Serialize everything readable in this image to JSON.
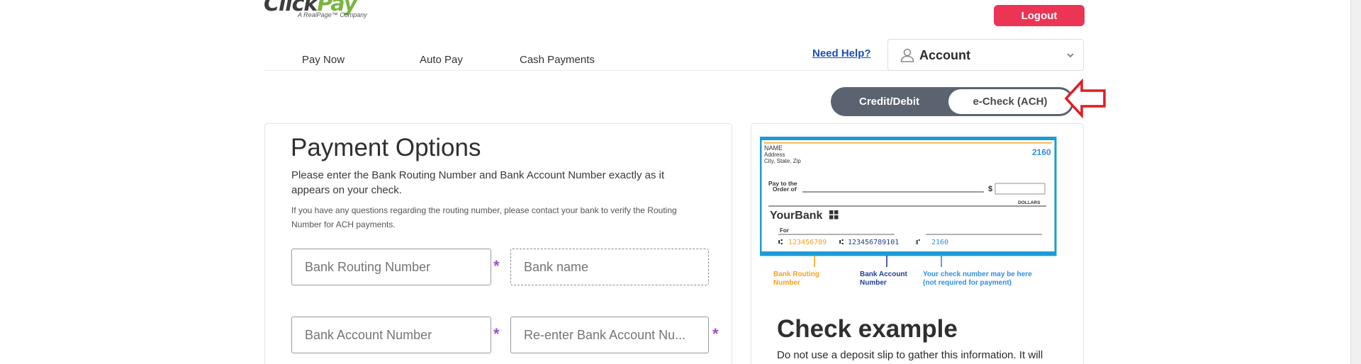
{
  "brand": {
    "logo_main": "ClickPay",
    "logo_main_a": "Click",
    "logo_main_b": "Pay",
    "logo_tagline": "A RealPage™ Company"
  },
  "header": {
    "logout_label": "Logout",
    "need_help_label": "Need Help?",
    "account_label": "Account",
    "icons": {
      "account": "person-icon",
      "dropdown": "chevron-down-icon"
    }
  },
  "nav": {
    "items": [
      {
        "label": "Pay Now"
      },
      {
        "label": "Auto Pay"
      },
      {
        "label": "Cash Payments"
      }
    ]
  },
  "toggle": {
    "options": [
      {
        "label": "Credit/Debit",
        "selected": false
      },
      {
        "label": "e-Check (ACH)",
        "selected": true
      }
    ],
    "annotation": "red-arrow-icon"
  },
  "payment": {
    "title": "Payment Options",
    "description": "Please enter the Bank Routing Number and Bank Account Number exactly as it appears on your check.",
    "note": "If you have any questions regarding the routing number, please contact your bank to verify the Routing Number for ACH payments.",
    "fields": {
      "routing_placeholder": "Bank Routing Number",
      "bank_name_placeholder": "Bank name",
      "account_placeholder": "Bank Account Number",
      "reenter_account_placeholder": "Re-enter Bank Account Nu..."
    },
    "required_mark": "*"
  },
  "check_example": {
    "title": "Check example",
    "description": "Do not use a deposit slip to gather this information. It will",
    "image": {
      "name_line": "NAME",
      "address_line": "Address",
      "city_line": "City, State, Zip",
      "check_number": "2160",
      "pay_to_line1": "Pay to the",
      "pay_to_line2": "Order of",
      "dollar_sign": "$",
      "dollars_label": "DOLLARS",
      "bank_label": "YourBank",
      "for_label": "For",
      "micr_routing": "123456789",
      "micr_account": "123456789101",
      "micr_check": "2160",
      "legend_routing_1": "Bank Routing",
      "legend_routing_2": "Number",
      "legend_account_1": "Bank Account",
      "legend_account_2": "Number",
      "legend_check_1": "Your check number may be here",
      "legend_check_2": "(not required for payment)"
    }
  },
  "colors": {
    "logout": "#ec3455",
    "toggle_bg": "#5c6370",
    "help_link": "#1b4fb4",
    "required": "#9b4fd1",
    "annotation_red": "#e01b24",
    "check_blue": "#1e9bd7",
    "routing_orange": "#f5a11c",
    "account_navy": "#1f3f8f",
    "checknum_blue": "#2f8ee0"
  }
}
